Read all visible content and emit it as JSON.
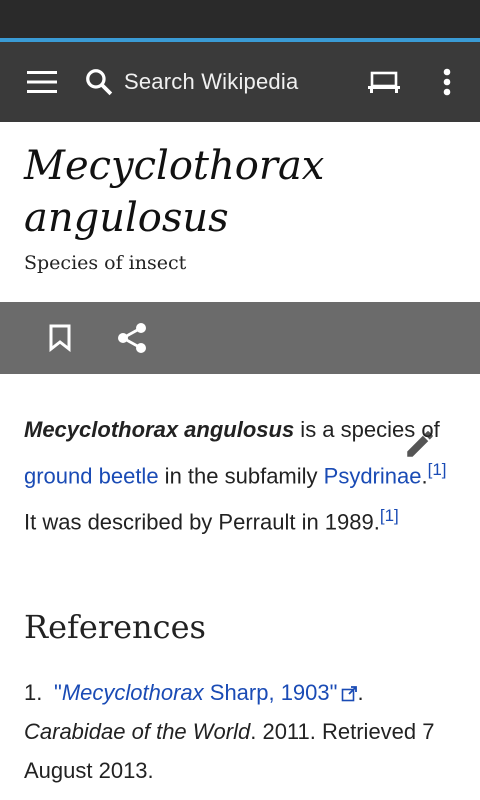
{
  "toolbar": {
    "search_placeholder": "Search Wikipedia"
  },
  "page": {
    "title_line1": "Mecyclothorax",
    "title_line2": "angulosus",
    "description": "Species of insect"
  },
  "article": {
    "subject": "Mecyclothorax angulosus",
    "text1": " is a species of ",
    "link_ground_beetle": "ground beetle",
    "text2": " in the subfamily ",
    "link_psydrinae": "Psydrinae",
    "text3": ".",
    "cite1": "[1]",
    "text4": " It was described by Perrault in 1989.",
    "cite2": "[1]"
  },
  "references": {
    "heading": "References",
    "items": [
      {
        "number": "1.",
        "quote_open": "\"",
        "genus": "Mecyclothorax",
        "rest": " Sharp, 1903",
        "quote_close": "\"",
        "after_link": ". ",
        "work": "Carabidae of the World",
        "tail": ". 2011. Retrieved 7 August 2013."
      }
    ]
  },
  "colors": {
    "status_bar": "#2a2a2a",
    "toolbar": "#3a3a3a",
    "progress": "#3a9bd5",
    "action_bar": "#6b6b6b",
    "link": "#1a4bb5"
  },
  "icons": [
    "menu-icon",
    "search-icon",
    "tabs-icon",
    "overflow-icon",
    "bookmark-icon",
    "share-icon",
    "edit-icon",
    "external-link-icon"
  ]
}
